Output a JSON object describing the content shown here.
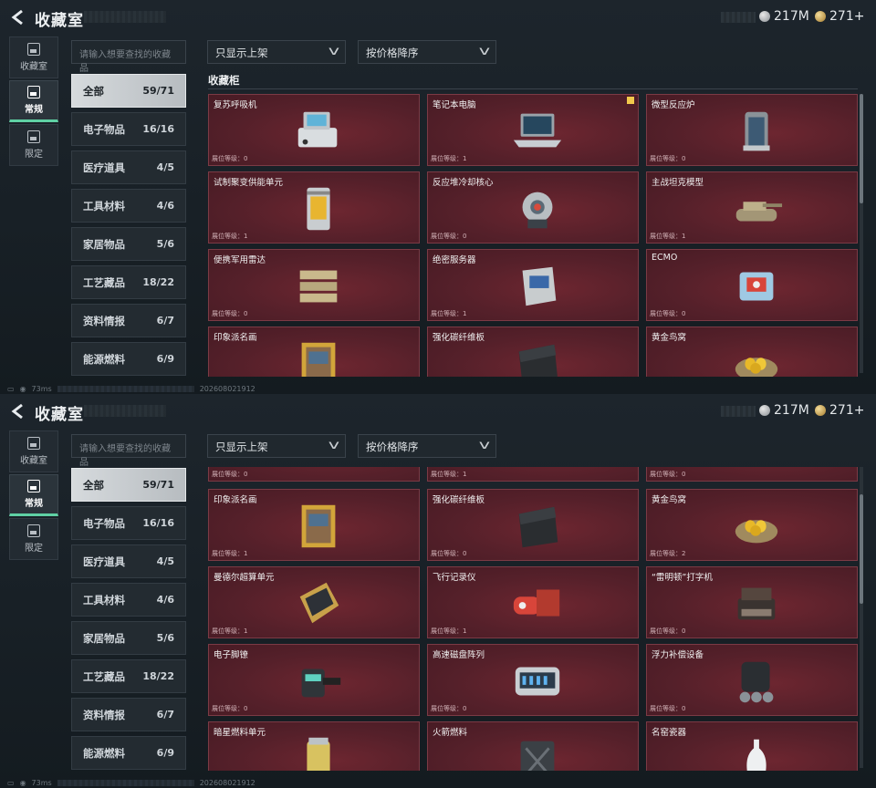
{
  "app": {
    "title": "收藏室"
  },
  "currency": {
    "silver": "217M",
    "gold": "271+"
  },
  "nav": [
    {
      "label": "收藏室",
      "icon": "vault-icon"
    },
    {
      "label": "常规",
      "icon": "image-icon",
      "active": true
    },
    {
      "label": "限定",
      "icon": "limited-icon"
    }
  ],
  "search": {
    "placeholder": "请输入想要查找的收藏品"
  },
  "filter": {
    "value": "只显示上架"
  },
  "sort": {
    "value": "按价格降序"
  },
  "categories": [
    {
      "label": "全部",
      "count": "59/71",
      "active": true
    },
    {
      "label": "电子物品",
      "count": "16/16"
    },
    {
      "label": "医疗道具",
      "count": "4/5"
    },
    {
      "label": "工具材料",
      "count": "4/6"
    },
    {
      "label": "家居物品",
      "count": "5/6"
    },
    {
      "label": "工艺藏品",
      "count": "18/22"
    },
    {
      "label": "资料情报",
      "count": "6/7"
    },
    {
      "label": "能源燃料",
      "count": "6/9"
    }
  ],
  "shelf": {
    "title": "收藏柜",
    "level_label": "展位等级："
  },
  "screen1_items": [
    {
      "name": "复苏呼吸机",
      "level": "0",
      "icon": "ventilator-icon"
    },
    {
      "name": "笔记本电脑",
      "level": "1",
      "icon": "laptop-icon",
      "flag": true
    },
    {
      "name": "微型反应炉",
      "level": "0",
      "icon": "reactor-icon"
    },
    {
      "name": "试制聚变供能单元",
      "level": "1",
      "icon": "fusion-cell-icon"
    },
    {
      "name": "反应堆冷却核心",
      "level": "0",
      "icon": "coolant-core-icon"
    },
    {
      "name": "主战坦克模型",
      "level": "1",
      "icon": "tank-icon"
    },
    {
      "name": "便携军用雷达",
      "level": "0",
      "icon": "radar-icon"
    },
    {
      "name": "绝密服务器",
      "level": "1",
      "icon": "server-icon"
    },
    {
      "name": "ECMO",
      "level": "0",
      "icon": "ecmo-icon"
    },
    {
      "name": "印象派名画",
      "level": "",
      "icon": "painting-icon"
    },
    {
      "name": "强化碳纤维板",
      "level": "",
      "icon": "carbon-plate-icon"
    },
    {
      "name": "黄金鸟窝",
      "level": "",
      "icon": "golden-nest-icon"
    }
  ],
  "screen2_partial_levels": [
    "0",
    "1",
    "0"
  ],
  "screen2_items": [
    {
      "name": "印象派名画",
      "level": "1",
      "icon": "painting-icon"
    },
    {
      "name": "强化碳纤维板",
      "level": "0",
      "icon": "carbon-plate-icon"
    },
    {
      "name": "黄金鸟窝",
      "level": "2",
      "icon": "golden-nest-icon"
    },
    {
      "name": "曼德尔超算单元",
      "level": "1",
      "icon": "supercomputer-icon"
    },
    {
      "name": "飞行记录仪",
      "level": "1",
      "icon": "flight-recorder-icon"
    },
    {
      "name": "“雷明顿”打字机",
      "level": "0",
      "icon": "typewriter-icon"
    },
    {
      "name": "电子脚镣",
      "level": "0",
      "icon": "ankle-monitor-icon"
    },
    {
      "name": "高速磁盘阵列",
      "level": "0",
      "icon": "disk-array-icon"
    },
    {
      "name": "浮力补偿设备",
      "level": "0",
      "icon": "bcd-icon"
    },
    {
      "name": "暗星燃料单元",
      "level": "",
      "icon": "fuel-cell-icon"
    },
    {
      "name": "火箭燃料",
      "level": "",
      "icon": "jerrycan-icon"
    },
    {
      "name": "名窑瓷器",
      "level": "",
      "icon": "porcelain-icon"
    }
  ],
  "status": {
    "ping": "73ms",
    "code": "20260802​1912"
  }
}
